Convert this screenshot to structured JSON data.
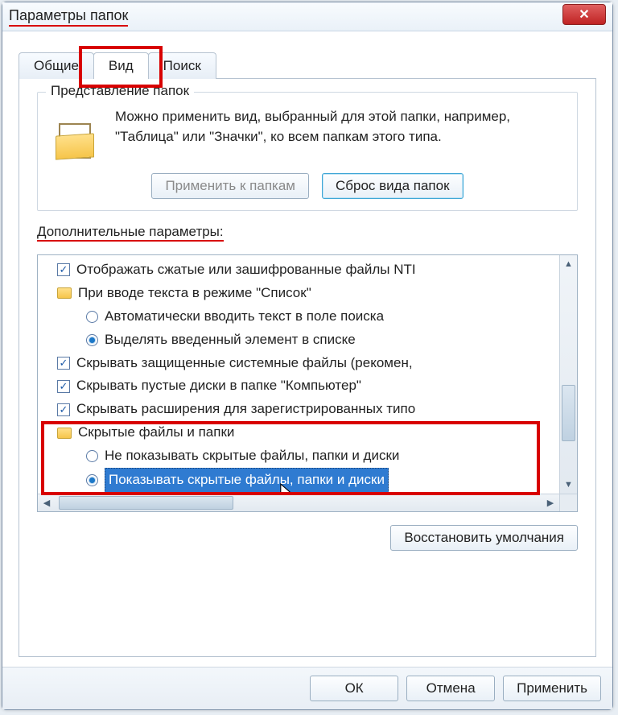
{
  "window": {
    "title": "Параметры папок",
    "close_glyph": "✕"
  },
  "tabs": {
    "general": "Общие",
    "view": "Вид",
    "search": "Поиск"
  },
  "folder_views": {
    "legend": "Представление папок",
    "text": "Можно применить вид, выбранный для этой папки, например, \"Таблица\" или \"Значки\", ко всем папкам этого типа.",
    "apply": "Применить к папкам",
    "reset": "Сброс вида папок"
  },
  "advanced": {
    "label": "Дополнительные параметры:",
    "items": {
      "ntfs_colors": "Отображать сжатые или зашифрованные файлы NTI",
      "type_in_list": "При вводе текста в режиме \"Список\"",
      "auto_type": "Автоматически вводить текст в поле поиска",
      "select_typed": "Выделять введенный элемент в списке",
      "hide_protected": "Скрывать защищенные системные файлы (рекомен,",
      "hide_empty": "Скрывать пустые диски в папке \"Компьютер\"",
      "hide_ext": "Скрывать расширения для зарегистрированных типо",
      "hidden_group": "Скрытые файлы и папки",
      "dont_show": "Не показывать скрытые файлы, папки и диски",
      "show_hidden": "Показывать скрытые файлы, папки и диски"
    }
  },
  "restore": "Восстановить умолчания",
  "buttons": {
    "ok": "ОК",
    "cancel": "Отмена",
    "apply": "Применить"
  },
  "scroll": {
    "up": "▲",
    "down": "▼",
    "left": "◀",
    "right": "▶"
  }
}
